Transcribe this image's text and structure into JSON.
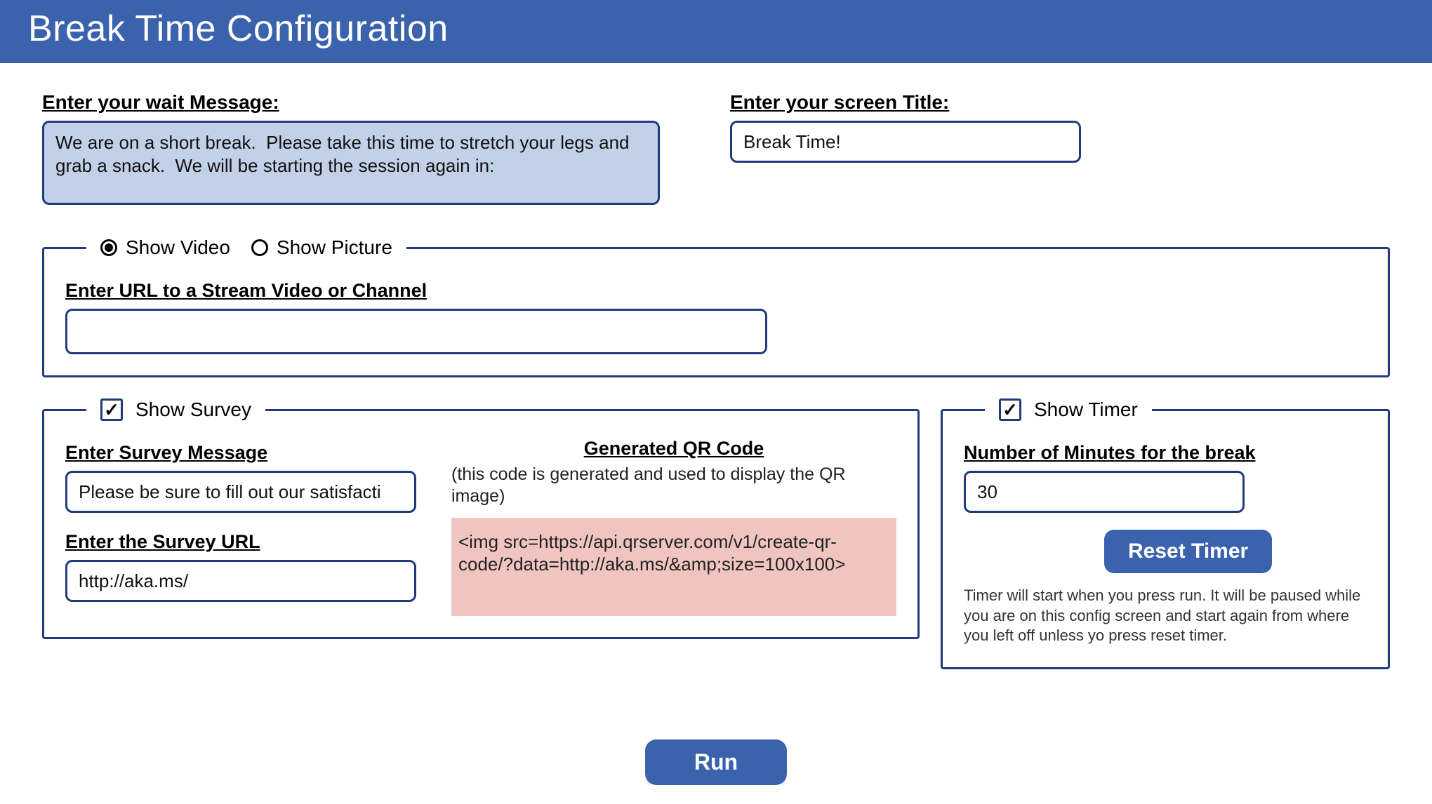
{
  "header": {
    "title": "Break Time Configuration"
  },
  "wait": {
    "label": "Enter your wait Message:",
    "value": "We are on a short break.  Please take this time to stretch your legs and grab a snack.  We will be starting the session again in:"
  },
  "screenTitle": {
    "label": "Enter your screen Title:",
    "value": "Break Time!"
  },
  "media": {
    "radio_video": "Show Video",
    "radio_picture": "Show Picture",
    "selected": "video",
    "url_label": "Enter URL to a Stream Video or Channel",
    "url_value": ""
  },
  "survey": {
    "checkbox_label": "Show Survey",
    "checked": true,
    "message_label": "Enter Survey Message",
    "message_value": "Please be sure to fill out our satisfacti",
    "url_label": "Enter the Survey URL",
    "url_value": "http://aka.ms/",
    "qr_title": "Generated QR Code ",
    "qr_note": "(this code is generated and used to display the QR image)",
    "qr_code": "<img src=https://api.qrserver.com/v1/create-qr-code/?data=http://aka.ms/&amp;size=100x100>"
  },
  "timer": {
    "checkbox_label": "Show Timer",
    "checked": true,
    "minutes_label": "Number of Minutes for the break ",
    "minutes_value": "30",
    "reset_label": "Reset Timer",
    "note": "Timer will start when you press run.  It will be paused while you are on this config screen and start again from where you left off unless yo press reset timer."
  },
  "run": {
    "label": "Run"
  }
}
